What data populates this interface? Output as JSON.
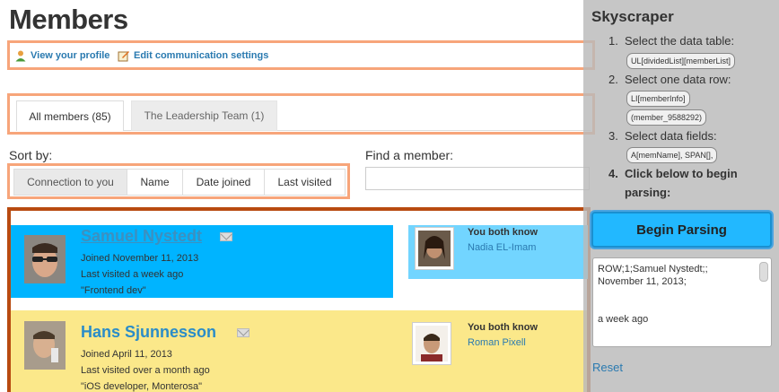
{
  "page": {
    "title": "Members"
  },
  "links": {
    "profile": "View your profile",
    "settings": "Edit communication settings"
  },
  "tabs": [
    {
      "label": "All members (85)"
    },
    {
      "label": "The Leadership Team (1)"
    }
  ],
  "sort": {
    "label": "Sort by:",
    "options": [
      "Connection to you",
      "Name",
      "Date joined",
      "Last visited"
    ]
  },
  "find": {
    "label": "Find a member:",
    "placeholder": ""
  },
  "members": [
    {
      "name": "Samuel Nystedt",
      "joined": "Joined November 11, 2013",
      "visited": "Last visited a week ago",
      "headline": "\"Frontend dev\"",
      "know_heading": "You both know",
      "know_name": "Nadia EL-Imam"
    },
    {
      "name": "Hans Sjunnesson",
      "joined": "Joined April 11, 2013",
      "visited": "Last visited over a month ago",
      "headline": "\"iOS developer, Monterosa\"",
      "know_heading": "You both know",
      "know_name": "Roman Pixell"
    }
  ],
  "panel": {
    "title": "Skyscraper",
    "steps": [
      {
        "num": "1.",
        "text": "Select the data table:",
        "chips": [
          "UL[dividedList][memberList]"
        ]
      },
      {
        "num": "2.",
        "text": "Select one data row:",
        "chips": [
          "LI[memberInfo]",
          "(member_9588292)"
        ]
      },
      {
        "num": "3.",
        "text": "Select data fields:",
        "chips": [
          "A[memName], SPAN[],"
        ]
      },
      {
        "num": "4.",
        "text": "Click below to begin",
        "text2": "parsing:"
      }
    ],
    "begin_label": "Begin Parsing",
    "output": "ROW;1;Samuel Nystedt;;\nNovember 11, 2013;\n\n\na week ago",
    "reset_label": "Reset"
  },
  "colors": {
    "highlight": "#f7a57a",
    "table_outline": "#b84a10",
    "row_selected": "#00b4ff",
    "row_field": "#72d5ff",
    "row_other": "#fbe88a",
    "link": "#2a7ab0",
    "button": "#22b8ff"
  }
}
